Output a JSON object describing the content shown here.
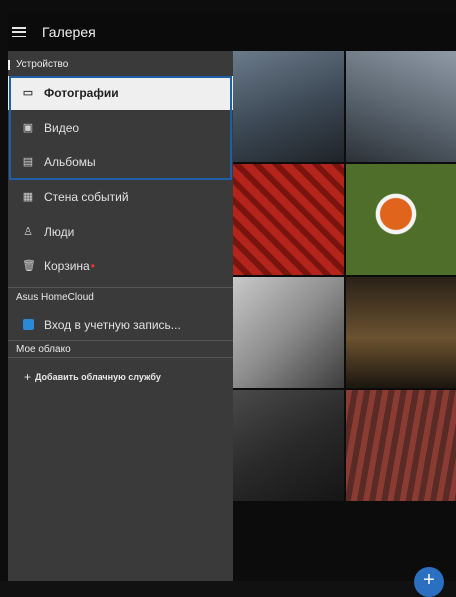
{
  "app": {
    "title": "Галерея"
  },
  "drawer": {
    "section_device": "Устройство",
    "items": [
      {
        "label": "Фотографии",
        "icon": "photos-icon",
        "glyph": "▭",
        "active": true
      },
      {
        "label": "Видео",
        "icon": "video-icon",
        "glyph": "▣",
        "active": false
      },
      {
        "label": "Альбомы",
        "icon": "albums-icon",
        "glyph": "▤",
        "active": false
      },
      {
        "label": "Стена событий",
        "icon": "event-wall-icon",
        "glyph": "▦",
        "active": false
      },
      {
        "label": "Люди",
        "icon": "people-icon",
        "glyph": "♙",
        "active": false
      },
      {
        "label": "Корзина",
        "icon": "trash-icon",
        "glyph": "🗑",
        "active": false
      }
    ],
    "section_homecloud": "Asus HomeCloud",
    "homecloud_login": "Вход в учетную запись...",
    "section_mycloud": "Мое облако",
    "add_cloud": "Добавить облачную службу"
  },
  "colors": {
    "accent": "#1e5fa8",
    "badge": "#e33333",
    "fab": "#2b6fc0"
  }
}
